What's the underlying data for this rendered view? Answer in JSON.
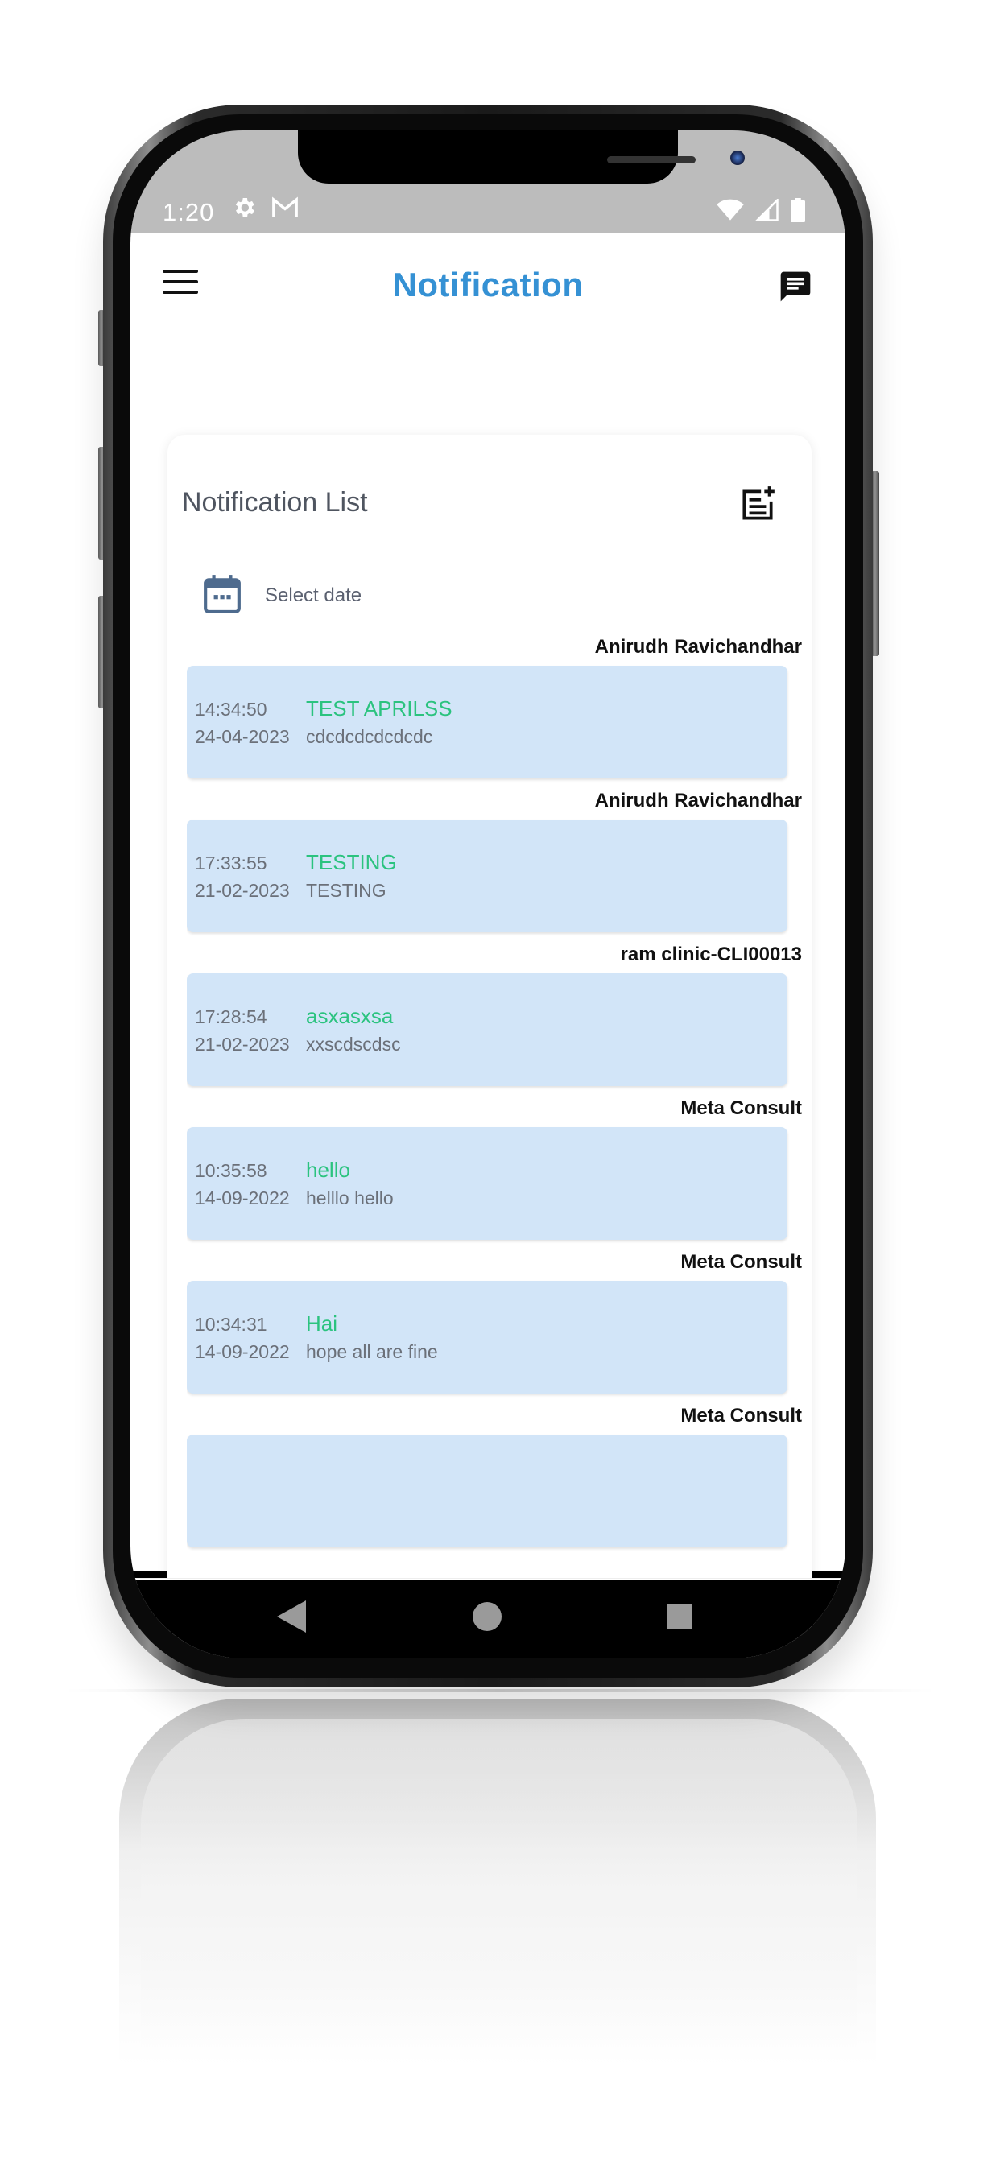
{
  "status": {
    "time": "1:20"
  },
  "appbar": {
    "title": "Notification"
  },
  "card": {
    "title": "Notification List",
    "date_placeholder": "Select date"
  },
  "notifications": [
    {
      "sender": "Anirudh Ravichandhar",
      "time": "14:34:50",
      "date": "24-04-2023",
      "title": "TEST APRILSS",
      "message": "cdcdcdcdcdcdc"
    },
    {
      "sender": "Anirudh Ravichandhar",
      "time": "17:33:55",
      "date": "21-02-2023",
      "title": "TESTING",
      "message": "TESTING"
    },
    {
      "sender": "ram clinic-CLI00013",
      "time": "17:28:54",
      "date": "21-02-2023",
      "title": "asxasxsa",
      "message": "xxscdscdsc"
    },
    {
      "sender": "Meta Consult",
      "time": "10:35:58",
      "date": "14-09-2022",
      "title": "hello",
      "message": "helllo hello"
    },
    {
      "sender": "Meta Consult",
      "time": "10:34:31",
      "date": "14-09-2022",
      "title": "Hai",
      "message": "hope all are fine"
    },
    {
      "sender": "Meta Consult",
      "time": "",
      "date": "",
      "title": "",
      "message": ""
    }
  ],
  "bottom_nav": [
    {
      "icon": "dashboard-icon"
    },
    {
      "icon": "calendar-icon"
    },
    {
      "icon": "documents-icon"
    },
    {
      "icon": "send-notification-icon"
    }
  ],
  "colors": {
    "title_blue": "#3591d4",
    "accent_green": "#2bc37f",
    "bubble_bg": "#d2e5f8",
    "nav_icon": "#4e6b8e",
    "nav_active": "#2a7ab8"
  }
}
